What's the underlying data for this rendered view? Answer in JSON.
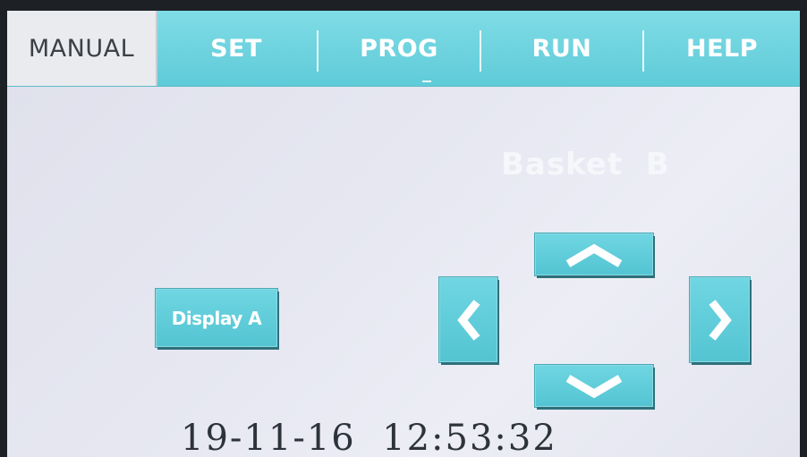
{
  "tabs": [
    {
      "label": "MANUAL",
      "active": true
    },
    {
      "label": "SET",
      "active": false
    },
    {
      "label": "PROG",
      "active": false
    },
    {
      "label": "RUN",
      "active": false
    },
    {
      "label": "HELP",
      "active": false
    }
  ],
  "basket_label": "Basket  B",
  "display_button_label": "Display A",
  "datetime": "19-11-16  12:53:32",
  "arrow_buttons": {
    "up": "chevron-up-icon",
    "down": "chevron-down-icon",
    "left": "chevron-left-icon",
    "right": "chevron-right-icon"
  },
  "colors": {
    "accent": "#5fcbd8",
    "button": "#5ccad7",
    "background": "#e4e5ef",
    "active_tab": "#e9ebef"
  }
}
